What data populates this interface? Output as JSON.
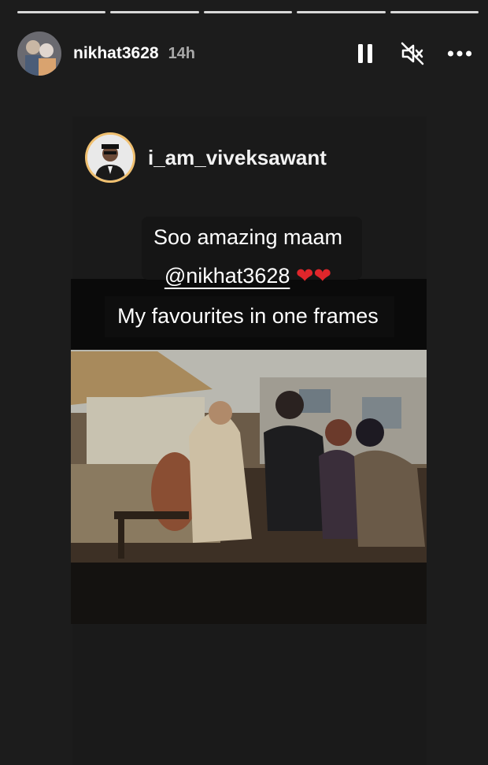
{
  "story": {
    "segments": [
      {
        "state": "done"
      },
      {
        "state": "done"
      },
      {
        "state": "done"
      },
      {
        "state": "done"
      },
      {
        "state": "active"
      }
    ],
    "username": "nikhat3628",
    "time": "14h"
  },
  "controls": {
    "pause_icon": "pause-icon",
    "mute_icon": "speaker-muted-icon",
    "more_icon": "more-horizontal-icon"
  },
  "shared_post": {
    "username": "i_am_viveksawant",
    "caption_line1": "Soo amazing maam",
    "mention": "@nikhat3628",
    "hearts": "❤❤",
    "caption_line3": "My favourites in one frames"
  },
  "colors": {
    "background": "#1c1c1c",
    "avatar_ring": "#f0c070",
    "heart": "#e0262b"
  }
}
